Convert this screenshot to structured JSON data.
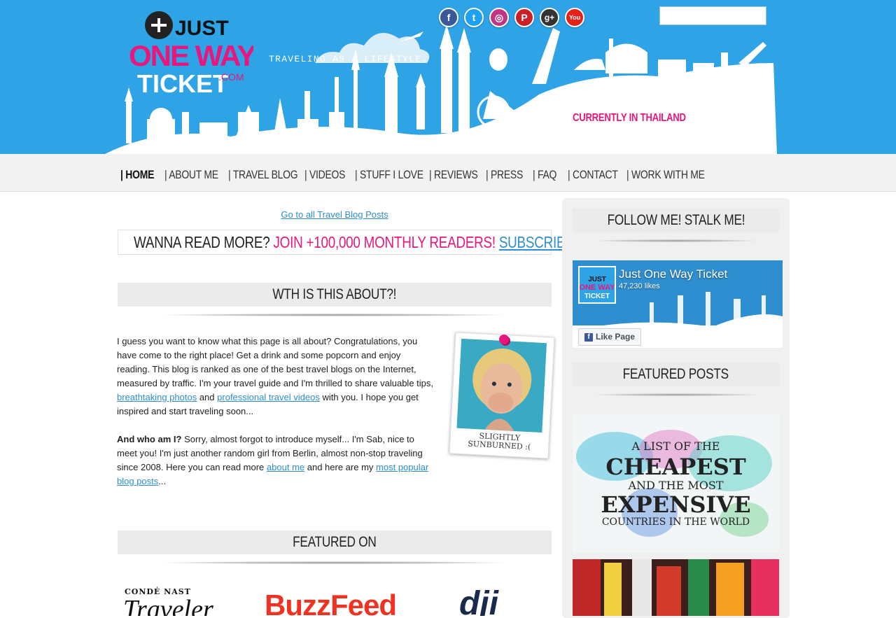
{
  "header": {
    "logo_text": [
      "JUST",
      "ONE WAY",
      "TICKET",
      ".COM"
    ],
    "tagline": "TRAVELING AS A LIFESTYLE.",
    "currently": "CURRENTLY IN THAILAND",
    "search_placeholder": "",
    "social": [
      {
        "name": "facebook-icon",
        "glyph": "f",
        "color": "#3b5998"
      },
      {
        "name": "twitter-icon",
        "glyph": "t",
        "color": "#1da1f2"
      },
      {
        "name": "instagram-icon",
        "glyph": "◎",
        "color": "#c13584"
      },
      {
        "name": "pinterest-icon",
        "glyph": "P",
        "color": "#cb2027"
      },
      {
        "name": "googleplus-icon",
        "glyph": "g+",
        "color": "#333333"
      },
      {
        "name": "youtube-icon",
        "glyph": "You",
        "color": "#e62117"
      }
    ]
  },
  "nav": {
    "items": [
      "| HOME",
      "| ABOUT ME",
      "| TRAVEL BLOG",
      "| VIDEOS",
      "| STUFF I LOVE",
      "| REVIEWS",
      "| PRESS",
      "| FAQ",
      "| CONTACT",
      "| WORK WITH ME"
    ]
  },
  "main": {
    "all_posts_link": "Go to all Travel Blog Posts",
    "subscribe": {
      "lead": "WANNA READ MORE?",
      "highlight": "JOIN +100,000 MONTHLY READERS!",
      "link": "SUBSCRIBE HERE"
    },
    "about_title": "WTH IS THIS ABOUT?!",
    "p1": {
      "a": "I guess you want to know what this page is all about? Congratulations, you have come to the right place! Get a drink and some popcorn and enjoy reading. This blog is ranked as one of the best travel blogs on the Internet, measured by traffic. I'm your travel guide and I'm thrilled to share valuable tips,",
      "link1": "breathtaking photos",
      "b": "and",
      "link2": "professional travel videos",
      "c": "with you. I hope you get inspired and start traveling soon..."
    },
    "p2": {
      "bold": "And who am I?",
      "a": "Sorry, almost forgot to introduce myself... I'm Sab, nice to meet you! I'm just another random girl from Berlin, almost non-stop traveling since 2008. Here you can read more",
      "link1": "about me",
      "b": "and here are my",
      "link2": "most popular blog posts",
      "c": "..."
    },
    "polaroid_caption": [
      "SLIGHTLY",
      "SUNBURNED :("
    ],
    "featured_title": "FEATURED ON",
    "featured_logos": [
      "CONDÉ NAST",
      "Traveler",
      "BuzzFeed",
      "dji"
    ]
  },
  "sidebar": {
    "follow_title": "FOLLOW ME! STALK ME!",
    "fb_name": "Just One Way Ticket",
    "fb_likes": "47,230 likes",
    "fb_button": "Like Page",
    "featured_title": "FEATURED POSTS",
    "post1_lines": [
      "A LIST OF THE",
      "CHEAPEST",
      "AND THE MOST",
      "EXPENSIVE",
      "COUNTRIES IN THE WORLD"
    ]
  }
}
